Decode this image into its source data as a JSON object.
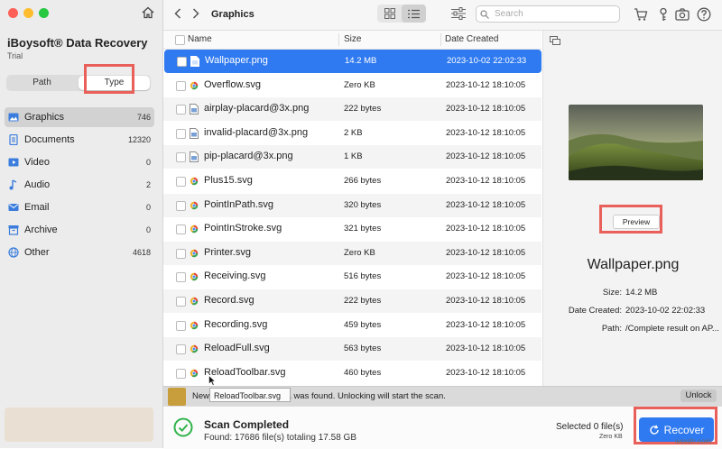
{
  "app": {
    "title": "iBoysoft® Data Recovery",
    "edition": "Trial"
  },
  "view_tabs": {
    "path": "Path",
    "type": "Type"
  },
  "categories": [
    {
      "label": "Graphics",
      "count": "746",
      "icon": "image-icon"
    },
    {
      "label": "Documents",
      "count": "12320",
      "icon": "document-icon"
    },
    {
      "label": "Video",
      "count": "0",
      "icon": "video-icon"
    },
    {
      "label": "Audio",
      "count": "2",
      "icon": "music-icon"
    },
    {
      "label": "Email",
      "count": "0",
      "icon": "mail-icon"
    },
    {
      "label": "Archive",
      "count": "0",
      "icon": "archive-icon"
    },
    {
      "label": "Other",
      "count": "4618",
      "icon": "globe-icon"
    }
  ],
  "toolbar": {
    "breadcrumb": "Graphics",
    "search_placeholder": "Search"
  },
  "table": {
    "columns": {
      "name": "Name",
      "size": "Size",
      "date": "Date Created"
    },
    "rows": [
      {
        "name": "Wallpaper.png",
        "size": "14.2 MB",
        "date": "2023-10-02 22:02:33"
      },
      {
        "name": "Overflow.svg",
        "size": "Zero KB",
        "date": "2023-10-12 18:10:05"
      },
      {
        "name": "airplay-placard@3x.png",
        "size": "222 bytes",
        "date": "2023-10-12 18:10:05"
      },
      {
        "name": "invalid-placard@3x.png",
        "size": "2 KB",
        "date": "2023-10-12 18:10:05"
      },
      {
        "name": "pip-placard@3x.png",
        "size": "1 KB",
        "date": "2023-10-12 18:10:05"
      },
      {
        "name": "Plus15.svg",
        "size": "266 bytes",
        "date": "2023-10-12 18:10:05"
      },
      {
        "name": "PointInPath.svg",
        "size": "320 bytes",
        "date": "2023-10-12 18:10:05"
      },
      {
        "name": "PointInStroke.svg",
        "size": "321 bytes",
        "date": "2023-10-12 18:10:05"
      },
      {
        "name": "Printer.svg",
        "size": "Zero KB",
        "date": "2023-10-12 18:10:05"
      },
      {
        "name": "Receiving.svg",
        "size": "516 bytes",
        "date": "2023-10-12 18:10:05"
      },
      {
        "name": "Record.svg",
        "size": "222 bytes",
        "date": "2023-10-12 18:10:05"
      },
      {
        "name": "Recording.svg",
        "size": "459 bytes",
        "date": "2023-10-12 18:10:05"
      },
      {
        "name": "ReloadFull.svg",
        "size": "563 bytes",
        "date": "2023-10-12 18:10:05"
      },
      {
        "name": "ReloadToolbar.svg",
        "size": "460 bytes",
        "date": "2023-10-12 18:10:05"
      }
    ]
  },
  "preview": {
    "button": "Preview",
    "file_name": "Wallpaper.png",
    "size_label": "Size:",
    "size_value": "14.2 MB",
    "date_label": "Date Created:",
    "date_value": "2023-10-02 22:02:33",
    "path_label": "Path:",
    "path_value": "/Complete result on AP..."
  },
  "banner": {
    "text": "New Macintosh HD - Data was found. Unlocking will start the scan.",
    "unlock": "Unlock",
    "tooltip": "ReloadToolbar.svg"
  },
  "status": {
    "title": "Scan Completed",
    "summary": "Found: 17686 file(s) totaling 17.58 GB",
    "selected": "Selected 0 file(s)",
    "selected_size": "Zero KB",
    "recover": "Recover"
  },
  "watermark": "wsxdn.com",
  "colors": {
    "accent": "#2f7af1",
    "highlight": "#e9605a",
    "success": "#2fb34a"
  }
}
